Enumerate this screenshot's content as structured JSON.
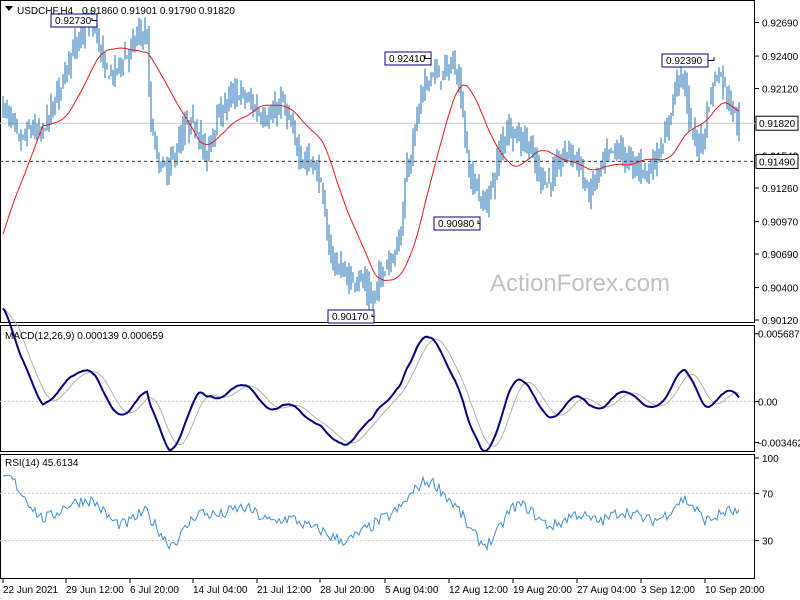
{
  "header": {
    "symbol": "USDCHF,H4",
    "ohlc": "0.91860 0.91901 0.91790 0.91820"
  },
  "watermark": "ActionForex.com",
  "colors": {
    "bg": "#ffffff",
    "frame": "#000000",
    "grid": "#c8c8c8",
    "price_bar": "#1e6fb4",
    "ma": "#e41a1c",
    "macd": "#00007f",
    "signal": "#b0b0b0",
    "rsi": "#3d8fd1",
    "watermark": "#c0c0c0"
  },
  "chart_data": [
    {
      "type": "ohlc",
      "name": "price",
      "title": "USDCHF,H4",
      "ylim": [
        0.9012,
        0.9285
      ],
      "y_ticks": [
        "0.92690",
        "0.92400",
        "0.92120",
        "0.91830",
        "0.91540",
        "0.91260",
        "0.90970",
        "0.90690",
        "0.90400",
        "0.90120"
      ],
      "y_tick_values": [
        0.9269,
        0.924,
        0.9212,
        0.9183,
        0.9154,
        0.9126,
        0.9097,
        0.9069,
        0.904,
        0.9012
      ],
      "current_price_label": "0.91820",
      "current_price": 0.9182,
      "level_label": "0.91490",
      "level": 0.9149,
      "close_path": [
        [
          0,
          0.9198
        ],
        [
          10,
          0.9188
        ],
        [
          20,
          0.9165
        ],
        [
          30,
          0.9178
        ],
        [
          40,
          0.9172
        ],
        [
          50,
          0.919
        ],
        [
          60,
          0.9215
        ],
        [
          70,
          0.924
        ],
        [
          80,
          0.9255
        ],
        [
          88,
          0.927
        ],
        [
          96,
          0.9262
        ],
        [
          104,
          0.923
        ],
        [
          112,
          0.9222
        ],
        [
          120,
          0.9235
        ],
        [
          130,
          0.9245
        ],
        [
          140,
          0.9262
        ],
        [
          147,
          0.9255
        ],
        [
          150,
          0.9185
        ],
        [
          158,
          0.915
        ],
        [
          166,
          0.914
        ],
        [
          176,
          0.9158
        ],
        [
          186,
          0.918
        ],
        [
          196,
          0.9182
        ],
        [
          206,
          0.915
        ],
        [
          212,
          0.9175
        ],
        [
          220,
          0.919
        ],
        [
          230,
          0.9205
        ],
        [
          240,
          0.9208
        ],
        [
          250,
          0.92
        ],
        [
          260,
          0.919
        ],
        [
          270,
          0.9185
        ],
        [
          282,
          0.9202
        ],
        [
          292,
          0.9175
        ],
        [
          302,
          0.915
        ],
        [
          312,
          0.9148
        ],
        [
          320,
          0.9135
        ],
        [
          326,
          0.909
        ],
        [
          334,
          0.906
        ],
        [
          342,
          0.9055
        ],
        [
          350,
          0.9045
        ],
        [
          358,
          0.905
        ],
        [
          366,
          0.904
        ],
        [
          372,
          0.9025
        ],
        [
          378,
          0.9045
        ],
        [
          386,
          0.906
        ],
        [
          394,
          0.907
        ],
        [
          400,
          0.9085
        ],
        [
          406,
          0.914
        ],
        [
          412,
          0.916
        ],
        [
          418,
          0.9195
        ],
        [
          425,
          0.9215
        ],
        [
          432,
          0.9226
        ],
        [
          440,
          0.9222
        ],
        [
          448,
          0.923
        ],
        [
          456,
          0.9232
        ],
        [
          462,
          0.92
        ],
        [
          466,
          0.916
        ],
        [
          470,
          0.9135
        ],
        [
          476,
          0.913
        ],
        [
          482,
          0.911
        ],
        [
          488,
          0.9118
        ],
        [
          494,
          0.9135
        ],
        [
          500,
          0.916
        ],
        [
          508,
          0.918
        ],
        [
          518,
          0.917
        ],
        [
          528,
          0.9165
        ],
        [
          538,
          0.914
        ],
        [
          548,
          0.913
        ],
        [
          558,
          0.9145
        ],
        [
          568,
          0.916
        ],
        [
          578,
          0.915
        ],
        [
          588,
          0.912
        ],
        [
          598,
          0.9138
        ],
        [
          608,
          0.9155
        ],
        [
          618,
          0.916
        ],
        [
          628,
          0.915
        ],
        [
          638,
          0.9145
        ],
        [
          648,
          0.914
        ],
        [
          658,
          0.9155
        ],
        [
          666,
          0.917
        ],
        [
          672,
          0.92
        ],
        [
          678,
          0.9225
        ],
        [
          684,
          0.922
        ],
        [
          690,
          0.918
        ],
        [
          696,
          0.9165
        ],
        [
          702,
          0.9165
        ],
        [
          708,
          0.9195
        ],
        [
          714,
          0.922
        ],
        [
          720,
          0.9225
        ],
        [
          726,
          0.921
        ],
        [
          732,
          0.9195
        ],
        [
          738,
          0.9182
        ]
      ],
      "annotations": [
        {
          "text": "0.92730",
          "value": 0.9273,
          "at": "29 Jun 12:00"
        },
        {
          "text": "0.90170",
          "value": 0.9017,
          "at": "28 Jul 20:00"
        },
        {
          "text": "0.92410",
          "value": 0.9241,
          "at": "5 Aug 04:00"
        },
        {
          "text": "0.90980",
          "value": 0.9098,
          "at": "12 Aug 12:00"
        },
        {
          "text": "0.92390",
          "value": 0.9239,
          "at": "10 Sep 20:00"
        }
      ]
    },
    {
      "type": "line",
      "name": "macd",
      "title": "MACD(12,26,9) 0.000139 0.000659",
      "ylim": [
        -0.004,
        0.006
      ],
      "y_ticks": [
        "0.005687",
        "0.00",
        "-0.003462"
      ],
      "y_tick_values": [
        0.005687,
        0.0,
        -0.003462
      ]
    },
    {
      "type": "line",
      "name": "rsi",
      "title": "RSI(14) 45.6134",
      "ylim": [
        0,
        100
      ],
      "y_ticks": [
        "100",
        "70",
        "30"
      ],
      "y_tick_values": [
        100,
        70,
        30
      ],
      "levels": [
        70,
        30
      ]
    }
  ],
  "x_axis": {
    "labels": [
      "22 Jun 2021",
      "29 Jun 12:00",
      "6 Jul 20:00",
      "14 Jul 04:00",
      "21 Jul 12:00",
      "28 Jul 20:00",
      "5 Aug 04:00",
      "12 Aug 12:00",
      "19 Aug 20:00",
      "27 Aug 04:00",
      "3 Sep 12:00",
      "10 Sep 20:00"
    ]
  }
}
